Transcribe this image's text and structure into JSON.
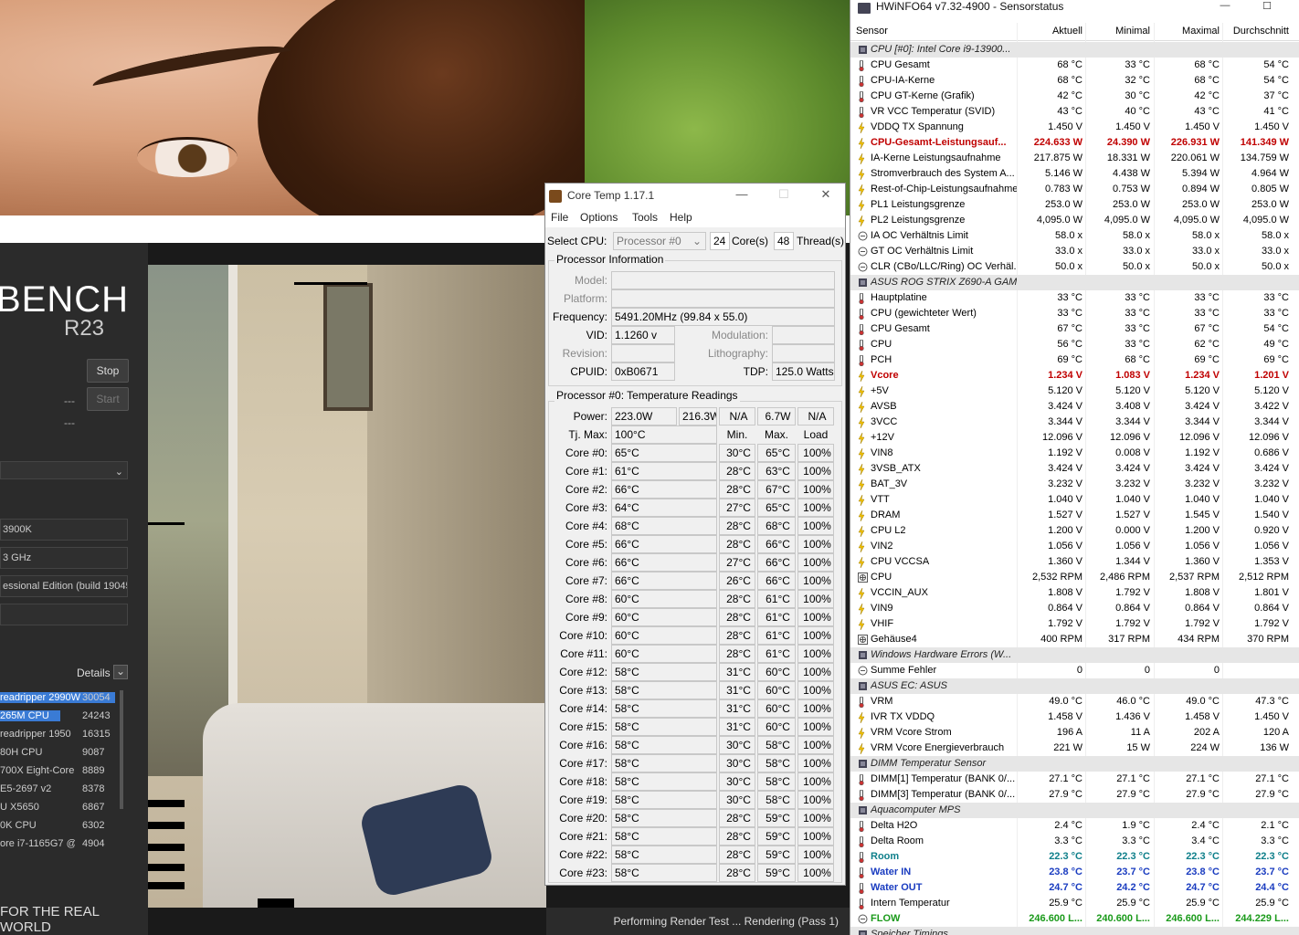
{
  "cinebench": {
    "logo": "BENCH",
    "version": "R23",
    "stop_label": "Stop",
    "start_label": "Start",
    "dash1": "---",
    "dash2": "---",
    "cpu_field": "3900K",
    "freq_field": "3 GHz",
    "os_field": "essional Edition (build 19045",
    "details_label": "Details",
    "ranking": [
      {
        "name": "readripper 2990W",
        "score": "30054"
      },
      {
        "name": "265M CPU",
        "score": "24243"
      },
      {
        "name": "readripper 1950",
        "score": "16315"
      },
      {
        "name": "80H CPU",
        "score": "9087"
      },
      {
        "name": "700X Eight-Core I",
        "score": "8889"
      },
      {
        "name": "E5-2697 v2",
        "score": "8378"
      },
      {
        "name": "U X5650",
        "score": "6867"
      },
      {
        "name": "0K CPU",
        "score": "6302"
      },
      {
        "name": "ore i7-1165G7 @",
        "score": "4904"
      }
    ],
    "footer": "FOR THE REAL WORLD",
    "status": "Performing Render Test ... Rendering (Pass 1)"
  },
  "coretemp": {
    "title": "Core Temp 1.17.1",
    "menu": [
      "File",
      "Options",
      "Tools",
      "Help"
    ],
    "select_cpu_label": "Select CPU:",
    "select_cpu_value": "Processor #0",
    "cores_value": "24",
    "cores_label": "Core(s)",
    "threads_value": "48",
    "threads_label": "Thread(s)",
    "proc_info_label": "Processor Information",
    "model_label": "Model:",
    "platform_label": "Platform:",
    "frequency_label": "Frequency:",
    "frequency_value": "5491.20MHz (99.84 x 55.0)",
    "vid_label": "VID:",
    "vid_value": "1.1260 v",
    "modulation_label": "Modulation:",
    "revision_label": "Revision:",
    "lithography_label": "Lithography:",
    "cpuid_label": "CPUID:",
    "cpuid_value": "0xB0671",
    "tdp_label": "TDP:",
    "tdp_value": "125.0 Watts",
    "temp_section_label": "Processor #0: Temperature Readings",
    "power_label": "Power:",
    "power_values": [
      "223.0W",
      "216.3W",
      "N/A",
      "6.7W",
      "N/A"
    ],
    "tjmax_label": "Tj. Max:",
    "tjmax_value": "100°C",
    "col_min": "Min.",
    "col_max": "Max.",
    "col_load": "Load",
    "cores": [
      {
        "label": "Core #0:",
        "temp": "65°C",
        "min": "30°C",
        "max": "65°C",
        "load": "100%"
      },
      {
        "label": "Core #1:",
        "temp": "61°C",
        "min": "28°C",
        "max": "63°C",
        "load": "100%"
      },
      {
        "label": "Core #2:",
        "temp": "66°C",
        "min": "28°C",
        "max": "67°C",
        "load": "100%"
      },
      {
        "label": "Core #3:",
        "temp": "64°C",
        "min": "27°C",
        "max": "65°C",
        "load": "100%"
      },
      {
        "label": "Core #4:",
        "temp": "68°C",
        "min": "28°C",
        "max": "68°C",
        "load": "100%"
      },
      {
        "label": "Core #5:",
        "temp": "66°C",
        "min": "28°C",
        "max": "66°C",
        "load": "100%"
      },
      {
        "label": "Core #6:",
        "temp": "66°C",
        "min": "27°C",
        "max": "66°C",
        "load": "100%"
      },
      {
        "label": "Core #7:",
        "temp": "66°C",
        "min": "26°C",
        "max": "66°C",
        "load": "100%"
      },
      {
        "label": "Core #8:",
        "temp": "60°C",
        "min": "28°C",
        "max": "61°C",
        "load": "100%"
      },
      {
        "label": "Core #9:",
        "temp": "60°C",
        "min": "28°C",
        "max": "61°C",
        "load": "100%"
      },
      {
        "label": "Core #10:",
        "temp": "60°C",
        "min": "28°C",
        "max": "61°C",
        "load": "100%"
      },
      {
        "label": "Core #11:",
        "temp": "60°C",
        "min": "28°C",
        "max": "61°C",
        "load": "100%"
      },
      {
        "label": "Core #12:",
        "temp": "58°C",
        "min": "31°C",
        "max": "60°C",
        "load": "100%"
      },
      {
        "label": "Core #13:",
        "temp": "58°C",
        "min": "31°C",
        "max": "60°C",
        "load": "100%"
      },
      {
        "label": "Core #14:",
        "temp": "58°C",
        "min": "31°C",
        "max": "60°C",
        "load": "100%"
      },
      {
        "label": "Core #15:",
        "temp": "58°C",
        "min": "31°C",
        "max": "60°C",
        "load": "100%"
      },
      {
        "label": "Core #16:",
        "temp": "58°C",
        "min": "30°C",
        "max": "58°C",
        "load": "100%"
      },
      {
        "label": "Core #17:",
        "temp": "58°C",
        "min": "30°C",
        "max": "58°C",
        "load": "100%"
      },
      {
        "label": "Core #18:",
        "temp": "58°C",
        "min": "30°C",
        "max": "58°C",
        "load": "100%"
      },
      {
        "label": "Core #19:",
        "temp": "58°C",
        "min": "30°C",
        "max": "58°C",
        "load": "100%"
      },
      {
        "label": "Core #20:",
        "temp": "58°C",
        "min": "28°C",
        "max": "59°C",
        "load": "100%"
      },
      {
        "label": "Core #21:",
        "temp": "58°C",
        "min": "28°C",
        "max": "59°C",
        "load": "100%"
      },
      {
        "label": "Core #22:",
        "temp": "58°C",
        "min": "28°C",
        "max": "59°C",
        "load": "100%"
      },
      {
        "label": "Core #23:",
        "temp": "58°C",
        "min": "28°C",
        "max": "59°C",
        "load": "100%"
      }
    ]
  },
  "hwinfo": {
    "title": "HWiNFO64 v7.32-4900 - Sensorstatus",
    "columns": [
      "Sensor",
      "Aktuell",
      "Minimal",
      "Maximal",
      "Durchschnitt"
    ],
    "rows": [
      {
        "group": true,
        "name": "CPU [#0]: Intel Core i9-13900..."
      },
      {
        "icon": "thermometer",
        "name": "CPU Gesamt",
        "cur": "68 °C",
        "min": "33 °C",
        "max": "68 °C",
        "avg": "54 °C"
      },
      {
        "icon": "thermometer",
        "name": "CPU-IA-Kerne",
        "cur": "68 °C",
        "min": "32 °C",
        "max": "68 °C",
        "avg": "54 °C"
      },
      {
        "icon": "thermometer",
        "name": "CPU GT-Kerne (Grafik)",
        "cur": "42 °C",
        "min": "30 °C",
        "max": "42 °C",
        "avg": "37 °C"
      },
      {
        "icon": "thermometer",
        "name": "VR VCC Temperatur (SVID)",
        "cur": "43 °C",
        "min": "40 °C",
        "max": "43 °C",
        "avg": "41 °C"
      },
      {
        "icon": "bolt",
        "name": "VDDQ TX Spannung",
        "cur": "1.450 V",
        "min": "1.450 V",
        "max": "1.450 V",
        "avg": "1.450 V"
      },
      {
        "icon": "bolt",
        "name": "CPU-Gesamt-Leistungsauf...",
        "cur": "224.633 W",
        "min": "24.390 W",
        "max": "226.931 W",
        "avg": "141.349 W",
        "style": "red"
      },
      {
        "icon": "bolt",
        "name": "IA-Kerne Leistungsaufnahme",
        "cur": "217.875 W",
        "min": "18.331 W",
        "max": "220.061 W",
        "avg": "134.759 W"
      },
      {
        "icon": "bolt",
        "name": "Stromverbrauch des System A...",
        "cur": "5.146 W",
        "min": "4.438 W",
        "max": "5.394 W",
        "avg": "4.964 W"
      },
      {
        "icon": "bolt",
        "name": "Rest-of-Chip-Leistungsaufnahme",
        "cur": "0.783 W",
        "min": "0.753 W",
        "max": "0.894 W",
        "avg": "0.805 W"
      },
      {
        "icon": "bolt",
        "name": "PL1 Leistungsgrenze",
        "cur": "253.0 W",
        "min": "253.0 W",
        "max": "253.0 W",
        "avg": "253.0 W"
      },
      {
        "icon": "bolt",
        "name": "PL2 Leistungsgrenze",
        "cur": "4,095.0 W",
        "min": "4,095.0 W",
        "max": "4,095.0 W",
        "avg": "4,095.0 W"
      },
      {
        "icon": "clock",
        "name": "IA OC Verhältnis Limit",
        "cur": "58.0 x",
        "min": "58.0 x",
        "max": "58.0 x",
        "avg": "58.0 x"
      },
      {
        "icon": "clock",
        "name": "GT OC Verhältnis Limit",
        "cur": "33.0 x",
        "min": "33.0 x",
        "max": "33.0 x",
        "avg": "33.0 x"
      },
      {
        "icon": "clock",
        "name": "CLR (CBo/LLC/Ring) OC Verhäl...",
        "cur": "50.0 x",
        "min": "50.0 x",
        "max": "50.0 x",
        "avg": "50.0 x"
      },
      {
        "group": true,
        "name": "ASUS ROG STRIX Z690-A GAM..."
      },
      {
        "icon": "thermometer",
        "name": "Hauptplatine",
        "cur": "33 °C",
        "min": "33 °C",
        "max": "33 °C",
        "avg": "33 °C"
      },
      {
        "icon": "thermometer",
        "name": "CPU (gewichteter Wert)",
        "cur": "33 °C",
        "min": "33 °C",
        "max": "33 °C",
        "avg": "33 °C"
      },
      {
        "icon": "thermometer",
        "name": "CPU Gesamt",
        "cur": "67 °C",
        "min": "33 °C",
        "max": "67 °C",
        "avg": "54 °C"
      },
      {
        "icon": "thermometer",
        "name": "CPU",
        "cur": "56 °C",
        "min": "33 °C",
        "max": "62 °C",
        "avg": "49 °C"
      },
      {
        "icon": "thermometer",
        "name": "PCH",
        "cur": "69 °C",
        "min": "68 °C",
        "max": "69 °C",
        "avg": "69 °C"
      },
      {
        "icon": "bolt",
        "name": "Vcore",
        "cur": "1.234 V",
        "min": "1.083 V",
        "max": "1.234 V",
        "avg": "1.201 V",
        "style": "red"
      },
      {
        "icon": "bolt",
        "name": "+5V",
        "cur": "5.120 V",
        "min": "5.120 V",
        "max": "5.120 V",
        "avg": "5.120 V"
      },
      {
        "icon": "bolt",
        "name": "AVSB",
        "cur": "3.424 V",
        "min": "3.408 V",
        "max": "3.424 V",
        "avg": "3.422 V"
      },
      {
        "icon": "bolt",
        "name": "3VCC",
        "cur": "3.344 V",
        "min": "3.344 V",
        "max": "3.344 V",
        "avg": "3.344 V"
      },
      {
        "icon": "bolt",
        "name": "+12V",
        "cur": "12.096 V",
        "min": "12.096 V",
        "max": "12.096 V",
        "avg": "12.096 V"
      },
      {
        "icon": "bolt",
        "name": "VIN8",
        "cur": "1.192 V",
        "min": "0.008 V",
        "max": "1.192 V",
        "avg": "0.686 V"
      },
      {
        "icon": "bolt",
        "name": "3VSB_ATX",
        "cur": "3.424 V",
        "min": "3.424 V",
        "max": "3.424 V",
        "avg": "3.424 V"
      },
      {
        "icon": "bolt",
        "name": "BAT_3V",
        "cur": "3.232 V",
        "min": "3.232 V",
        "max": "3.232 V",
        "avg": "3.232 V"
      },
      {
        "icon": "bolt",
        "name": "VTT",
        "cur": "1.040 V",
        "min": "1.040 V",
        "max": "1.040 V",
        "avg": "1.040 V"
      },
      {
        "icon": "bolt",
        "name": "DRAM",
        "cur": "1.527 V",
        "min": "1.527 V",
        "max": "1.545 V",
        "avg": "1.540 V"
      },
      {
        "icon": "bolt",
        "name": "CPU L2",
        "cur": "1.200 V",
        "min": "0.000 V",
        "max": "1.200 V",
        "avg": "0.920 V"
      },
      {
        "icon": "bolt",
        "name": "VIN2",
        "cur": "1.056 V",
        "min": "1.056 V",
        "max": "1.056 V",
        "avg": "1.056 V"
      },
      {
        "icon": "bolt",
        "name": "CPU VCCSA",
        "cur": "1.360 V",
        "min": "1.344 V",
        "max": "1.360 V",
        "avg": "1.353 V"
      },
      {
        "icon": "fan",
        "name": "CPU",
        "cur": "2,532 RPM",
        "min": "2,486 RPM",
        "max": "2,537 RPM",
        "avg": "2,512 RPM"
      },
      {
        "icon": "bolt",
        "name": "VCCIN_AUX",
        "cur": "1.808 V",
        "min": "1.792 V",
        "max": "1.808 V",
        "avg": "1.801 V"
      },
      {
        "icon": "bolt",
        "name": "VIN9",
        "cur": "0.864 V",
        "min": "0.864 V",
        "max": "0.864 V",
        "avg": "0.864 V"
      },
      {
        "icon": "bolt",
        "name": "VHIF",
        "cur": "1.792 V",
        "min": "1.792 V",
        "max": "1.792 V",
        "avg": "1.792 V"
      },
      {
        "icon": "fan",
        "name": "Gehäuse4",
        "cur": "400 RPM",
        "min": "317 RPM",
        "max": "434 RPM",
        "avg": "370 RPM"
      },
      {
        "group": true,
        "name": "Windows Hardware Errors (W..."
      },
      {
        "icon": "clock",
        "name": "Summe Fehler",
        "cur": "0",
        "min": "0",
        "max": "0",
        "avg": ""
      },
      {
        "group": true,
        "name": "ASUS EC: ASUS"
      },
      {
        "icon": "thermometer",
        "name": "VRM",
        "cur": "49.0 °C",
        "min": "46.0 °C",
        "max": "49.0 °C",
        "avg": "47.3 °C"
      },
      {
        "icon": "bolt",
        "name": "IVR TX VDDQ",
        "cur": "1.458 V",
        "min": "1.436 V",
        "max": "1.458 V",
        "avg": "1.450 V"
      },
      {
        "icon": "bolt",
        "name": "VRM Vcore Strom",
        "cur": "196 A",
        "min": "11 A",
        "max": "202 A",
        "avg": "120 A"
      },
      {
        "icon": "bolt",
        "name": "VRM Vcore Energieverbrauch",
        "cur": "221 W",
        "min": "15 W",
        "max": "224 W",
        "avg": "136 W"
      },
      {
        "group": true,
        "name": "DIMM Temperatur Sensor"
      },
      {
        "icon": "thermometer",
        "name": "DIMM[1] Temperatur (BANK 0/...",
        "cur": "27.1 °C",
        "min": "27.1 °C",
        "max": "27.1 °C",
        "avg": "27.1 °C"
      },
      {
        "icon": "thermometer",
        "name": "DIMM[3] Temperatur (BANK 0/...",
        "cur": "27.9 °C",
        "min": "27.9 °C",
        "max": "27.9 °C",
        "avg": "27.9 °C"
      },
      {
        "group": true,
        "name": "Aquacomputer MPS"
      },
      {
        "icon": "thermometer",
        "name": "Delta H2O",
        "cur": "2.4 °C",
        "min": "1.9 °C",
        "max": "2.4 °C",
        "avg": "2.1 °C"
      },
      {
        "icon": "thermometer",
        "name": "Delta Room",
        "cur": "3.3 °C",
        "min": "3.3 °C",
        "max": "3.4 °C",
        "avg": "3.3 °C"
      },
      {
        "icon": "thermometer",
        "name": "Room",
        "cur": "22.3 °C",
        "min": "22.3 °C",
        "max": "22.3 °C",
        "avg": "22.3 °C",
        "style": "teal"
      },
      {
        "icon": "thermometer",
        "name": "Water IN",
        "cur": "23.8 °C",
        "min": "23.7 °C",
        "max": "23.8 °C",
        "avg": "23.7 °C",
        "style": "blue"
      },
      {
        "icon": "thermometer",
        "name": "Water OUT",
        "cur": "24.7 °C",
        "min": "24.2 °C",
        "max": "24.7 °C",
        "avg": "24.4 °C",
        "style": "blue"
      },
      {
        "icon": "thermometer",
        "name": "Intern Temperatur",
        "cur": "25.9 °C",
        "min": "25.9 °C",
        "max": "25.9 °C",
        "avg": "25.9 °C"
      },
      {
        "icon": "clock",
        "name": "FLOW",
        "cur": "246.600 L...",
        "min": "240.600 L...",
        "max": "246.600 L...",
        "avg": "244.229 L...",
        "style": "green"
      },
      {
        "group": true,
        "name": "Speicher Timings"
      }
    ]
  }
}
